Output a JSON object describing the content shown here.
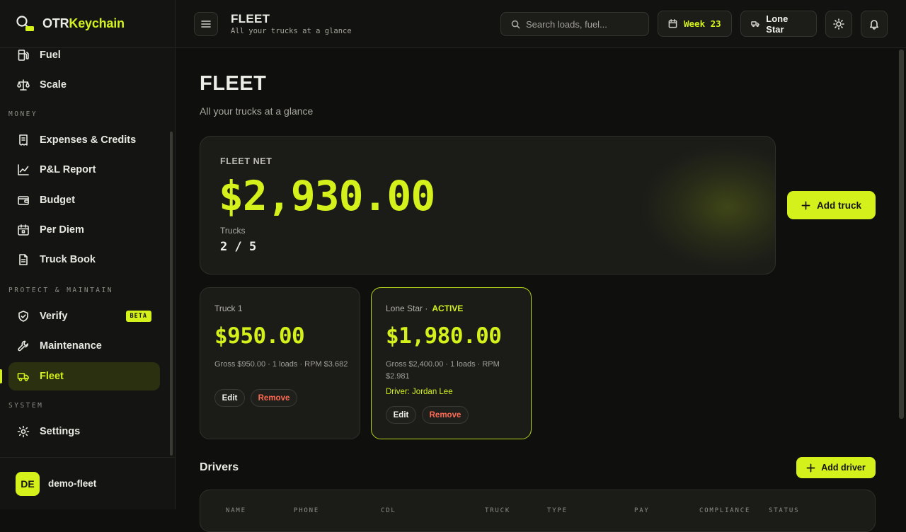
{
  "brand": {
    "name_prefix": "OTR",
    "name_suffix": "Keychain",
    "accent": "#d4f11c"
  },
  "sidebar": {
    "items": [
      {
        "id": "fuel",
        "label": "Fuel",
        "icon": "fuel-pump-icon"
      },
      {
        "id": "scale",
        "label": "Scale",
        "icon": "scale-icon"
      },
      {
        "id": "expenses",
        "label": "Expenses & Credits",
        "icon": "receipt-icon"
      },
      {
        "id": "pl",
        "label": "P&L Report",
        "icon": "line-chart-icon"
      },
      {
        "id": "budget",
        "label": "Budget",
        "icon": "wallet-icon"
      },
      {
        "id": "perdiem",
        "label": "Per Diem",
        "icon": "calendar-icon"
      },
      {
        "id": "truckbook",
        "label": "Truck Book",
        "icon": "document-icon"
      },
      {
        "id": "verify",
        "label": "Verify",
        "icon": "shield-check-icon",
        "badge": "BETA"
      },
      {
        "id": "maintenance",
        "label": "Maintenance",
        "icon": "wrench-icon"
      },
      {
        "id": "fleet",
        "label": "Fleet",
        "icon": "truck-icon",
        "active": true
      },
      {
        "id": "settings",
        "label": "Settings",
        "icon": "gear-icon"
      }
    ],
    "sections": {
      "money": "MONEY",
      "protect": "PROTECT & MAINTAIN",
      "system": "SYSTEM"
    },
    "user": {
      "initials": "DE",
      "name": "demo-fleet"
    }
  },
  "header": {
    "title": "FLEET",
    "subtitle": "All your trucks at a glance",
    "search_placeholder": "Search loads, fuel...",
    "week": "Week 23",
    "truck": "Lone Star"
  },
  "main": {
    "title": "FLEET",
    "subtitle": "All your trucks at a glance",
    "fleet_net": {
      "label": "FLEET NET",
      "value": "$2,930.00",
      "trucks_label": "Trucks",
      "trucks_value": "2 / 5"
    },
    "add_truck": "Add truck",
    "trucks": [
      {
        "name": "Truck 1",
        "status": "",
        "net": "$950.00",
        "meta": "Gross $950.00 · 1 loads · RPM $3.682",
        "driver": "",
        "edit": "Edit",
        "remove": "Remove"
      },
      {
        "name": "Lone Star ·",
        "status": "ACTIVE",
        "net": "$1,980.00",
        "meta": "Gross $2,400.00 · 1 loads · RPM $2.981",
        "driver": "Driver: Jordan Lee",
        "edit": "Edit",
        "remove": "Remove"
      }
    ],
    "drivers_title": "Drivers",
    "add_driver": "Add driver",
    "drivers_columns": [
      "NAME",
      "PHONE",
      "CDL",
      "TRUCK",
      "TYPE",
      "PAY",
      "COMPLIANCE",
      "STATUS"
    ]
  }
}
